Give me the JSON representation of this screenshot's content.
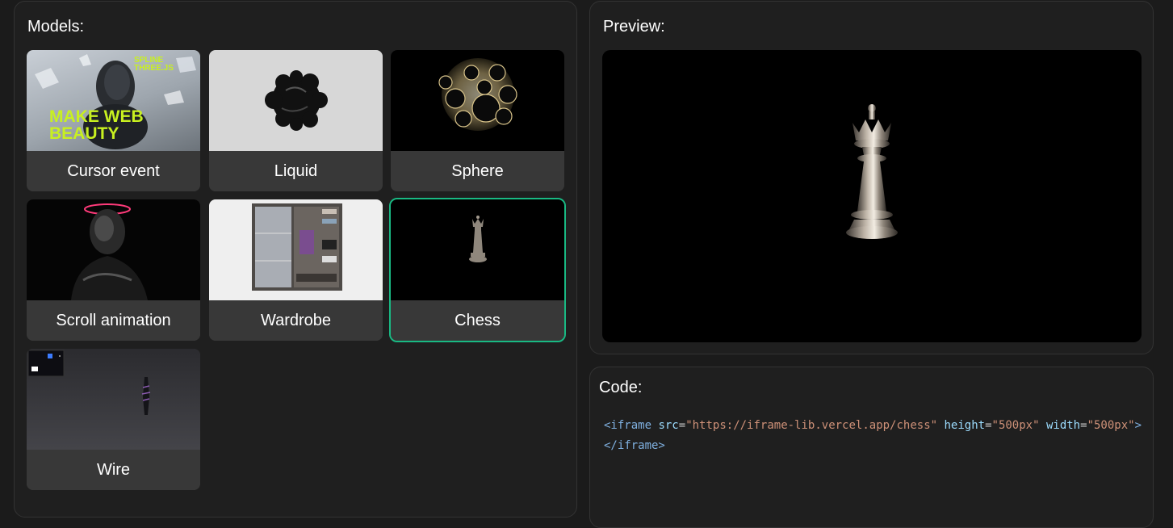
{
  "models": {
    "title": "Models:",
    "items": [
      {
        "label": "Cursor event",
        "thumb_text_top": "SPLINE THREE.JS",
        "thumb_text_main": "MAKE WEB BEAUTY"
      },
      {
        "label": "Liquid"
      },
      {
        "label": "Sphere"
      },
      {
        "label": "Scroll animation"
      },
      {
        "label": "Wardrobe"
      },
      {
        "label": "Chess",
        "selected": true
      },
      {
        "label": "Wire"
      }
    ]
  },
  "preview": {
    "title": "Preview:"
  },
  "code": {
    "title": "Code:",
    "tag_open": "<iframe",
    "attr_src": "src",
    "val_src": "\"https://iframe-lib.vercel.app/chess\"",
    "attr_height": "height",
    "val_height": "\"500px\"",
    "attr_width": "width",
    "val_width": "\"500px\"",
    "tag_close": "></iframe>",
    "equals": "="
  },
  "colors": {
    "accent": "#19b983",
    "panel_bg": "#1f1f1f",
    "card_label_bg": "#383838"
  }
}
